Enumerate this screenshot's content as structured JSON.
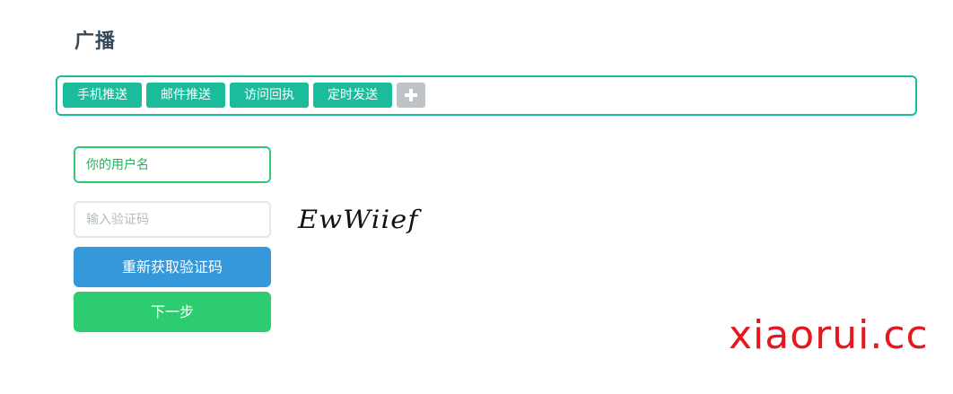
{
  "page": {
    "title": "广播"
  },
  "tags": {
    "items": [
      {
        "label": "手机推送"
      },
      {
        "label": "邮件推送"
      },
      {
        "label": "访问回执"
      },
      {
        "label": "定时发送"
      }
    ]
  },
  "form": {
    "username_placeholder": "你的用户名",
    "code_placeholder": "输入验证码",
    "captcha_text": "EwWiief",
    "refresh_label": "重新获取验证码",
    "next_label": "下一步"
  },
  "watermark": {
    "text": "xiaorui.cc"
  },
  "colors": {
    "tag_green": "#1abc9c",
    "primary_green": "#2ecc71",
    "blue": "#3498db",
    "gray": "#bdc3c7",
    "watermark_red": "#e5171f"
  },
  "icons": {
    "add": "plus-icon"
  }
}
